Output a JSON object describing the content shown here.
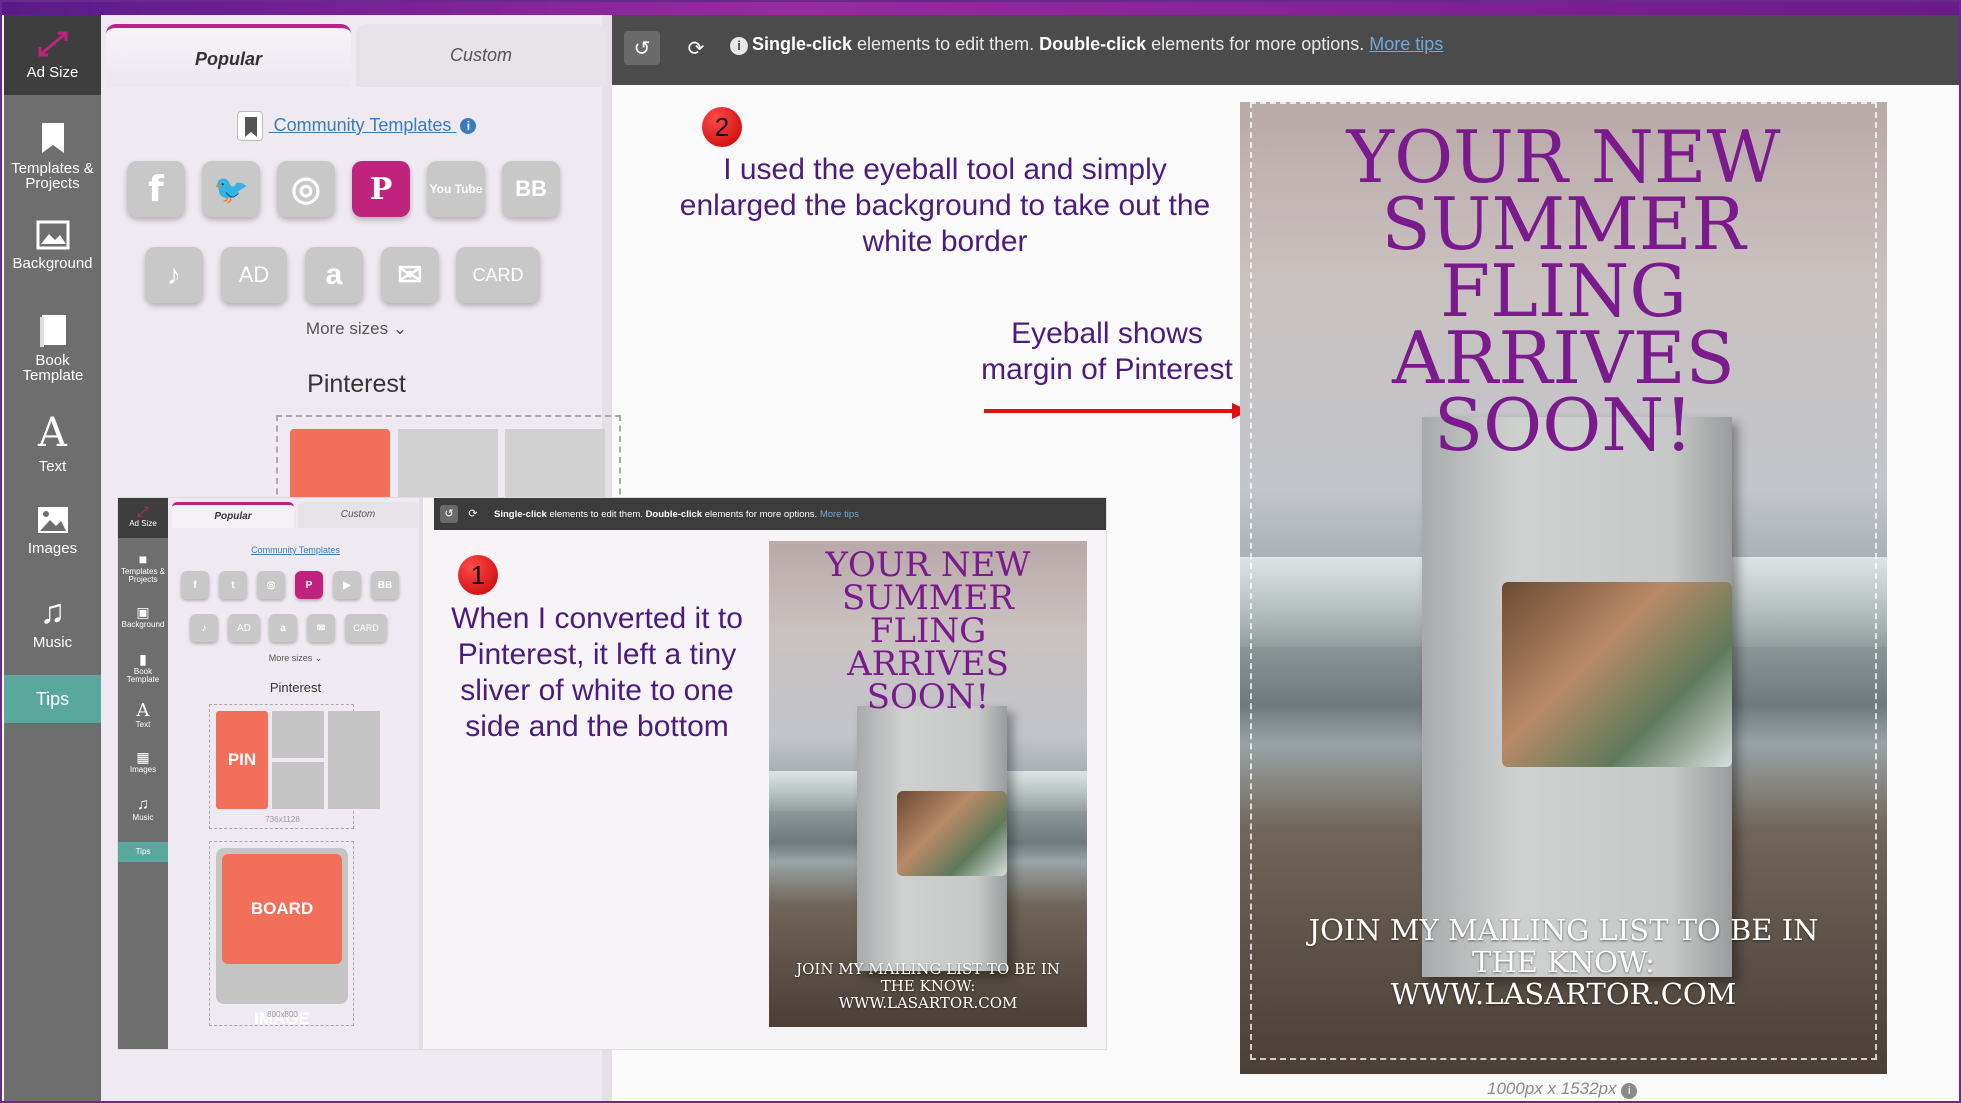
{
  "sidebar": {
    "items": [
      {
        "label": "Ad Size"
      },
      {
        "label": "Templates & Projects"
      },
      {
        "label": "Background"
      },
      {
        "label": "Book Template"
      },
      {
        "label": "Text"
      },
      {
        "label": "Images"
      },
      {
        "label": "Music"
      }
    ],
    "tips_label": "Tips"
  },
  "panel": {
    "tabs": [
      {
        "label": "Popular"
      },
      {
        "label": "Custom"
      }
    ],
    "community_templates": "Community Templates",
    "info_glyph": "i",
    "tiles_row1": [
      {
        "icon": "facebook-icon",
        "glyph": "f"
      },
      {
        "icon": "twitter-icon",
        "glyph": "🐦"
      },
      {
        "icon": "instagram-icon",
        "glyph": "◎"
      },
      {
        "icon": "pinterest-icon",
        "glyph": "P"
      },
      {
        "icon": "youtube-icon",
        "glyph": "You Tube"
      },
      {
        "icon": "bb-icon",
        "glyph": "BB"
      }
    ],
    "tiles_row2": [
      {
        "icon": "tiktok-icon",
        "glyph": "♪"
      },
      {
        "icon": "ad-icon",
        "glyph": "AD"
      },
      {
        "icon": "amazon-icon",
        "glyph": "a"
      },
      {
        "icon": "mail-icon",
        "glyph": "✉"
      },
      {
        "icon": "card-icon",
        "glyph": "CARD"
      }
    ],
    "more_sizes": "More sizes",
    "section_title": "Pinterest"
  },
  "toolbar": {
    "hint_single": "Single-click",
    "hint_mid": " elements to edit them. ",
    "hint_double": "Double-click",
    "hint_end": " elements for more options. ",
    "more_tips": "More tips"
  },
  "inset": {
    "tabs": [
      {
        "label": "Popular"
      },
      {
        "label": "Custom"
      }
    ],
    "community_templates": "Community Templates",
    "more_sizes": "More sizes",
    "section_title": "Pinterest",
    "pin_label": "PIN",
    "pin_dims": "736x1128",
    "board_label": "BOARD IMAGE",
    "board_dims": "800x800",
    "hint_single": "Single-click",
    "hint_mid": " elements to edit them. ",
    "hint_double": "Double-click",
    "hint_end": " elements for more options. ",
    "more_tips": "More tips",
    "sidebar": [
      "Ad Size",
      "Templates & Projects",
      "Background",
      "Book Template",
      "Text",
      "Images",
      "Music",
      "Tips"
    ],
    "tiles_row1": [
      "f",
      "t",
      "◎",
      "P",
      "▶",
      "BB"
    ],
    "tiles_row2": [
      "♪",
      "AD",
      "a",
      "✉",
      "CARD"
    ]
  },
  "annotations": {
    "badge1": "1",
    "badge2": "2",
    "note1": "When I converted it to Pinterest, it left a tiny sliver of white to one side and the bottom",
    "note2": "I used the eyeball tool and simply enlarged the background to take out the white border",
    "note3": "Eyeball shows margin of Pinterest"
  },
  "poster": {
    "title_lines": [
      "YOUR NEW",
      "SUMMER",
      "FLING",
      "ARRIVES",
      "SOON!"
    ],
    "footer_lines": [
      "JOIN MY MAILING LIST TO BE IN",
      "THE KNOW:",
      "WWW.LASARTOR.COM"
    ],
    "dimensions": "1000px x 1532px",
    "colors": {
      "title": "#7a1a8c",
      "arrow": "#e01010",
      "accent": "#c0237d",
      "tips": "#5aa79e"
    }
  }
}
